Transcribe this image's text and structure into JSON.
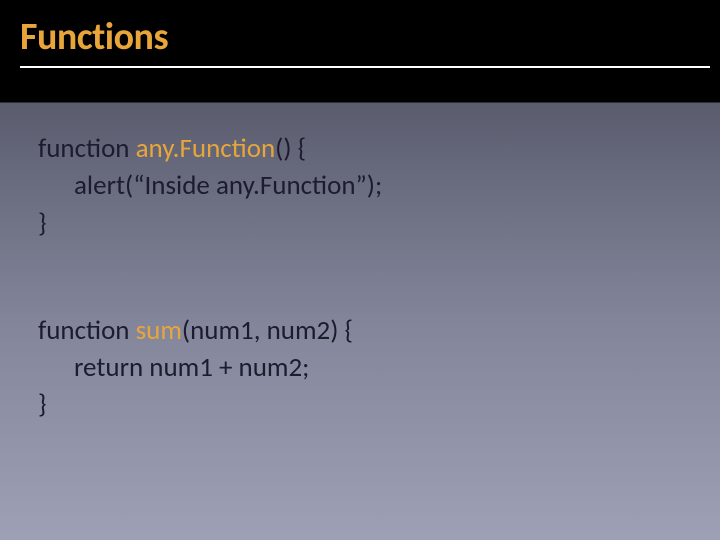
{
  "header": {
    "title": "Functions"
  },
  "code": {
    "func1": {
      "kw": "function",
      "name": " any.Function",
      "sig_open": "()",
      "brace_open": " {",
      "body": "alert(“Inside any.Function”);",
      "brace_close": "}"
    },
    "func2": {
      "kw": "function",
      "name": " sum",
      "sig_open": "(",
      "param1": "num1",
      "comma": ", ",
      "param2": "num2",
      "sig_close": ")",
      "brace_open": " {",
      "body": "return num1 + num2;",
      "brace_close": "}"
    }
  }
}
